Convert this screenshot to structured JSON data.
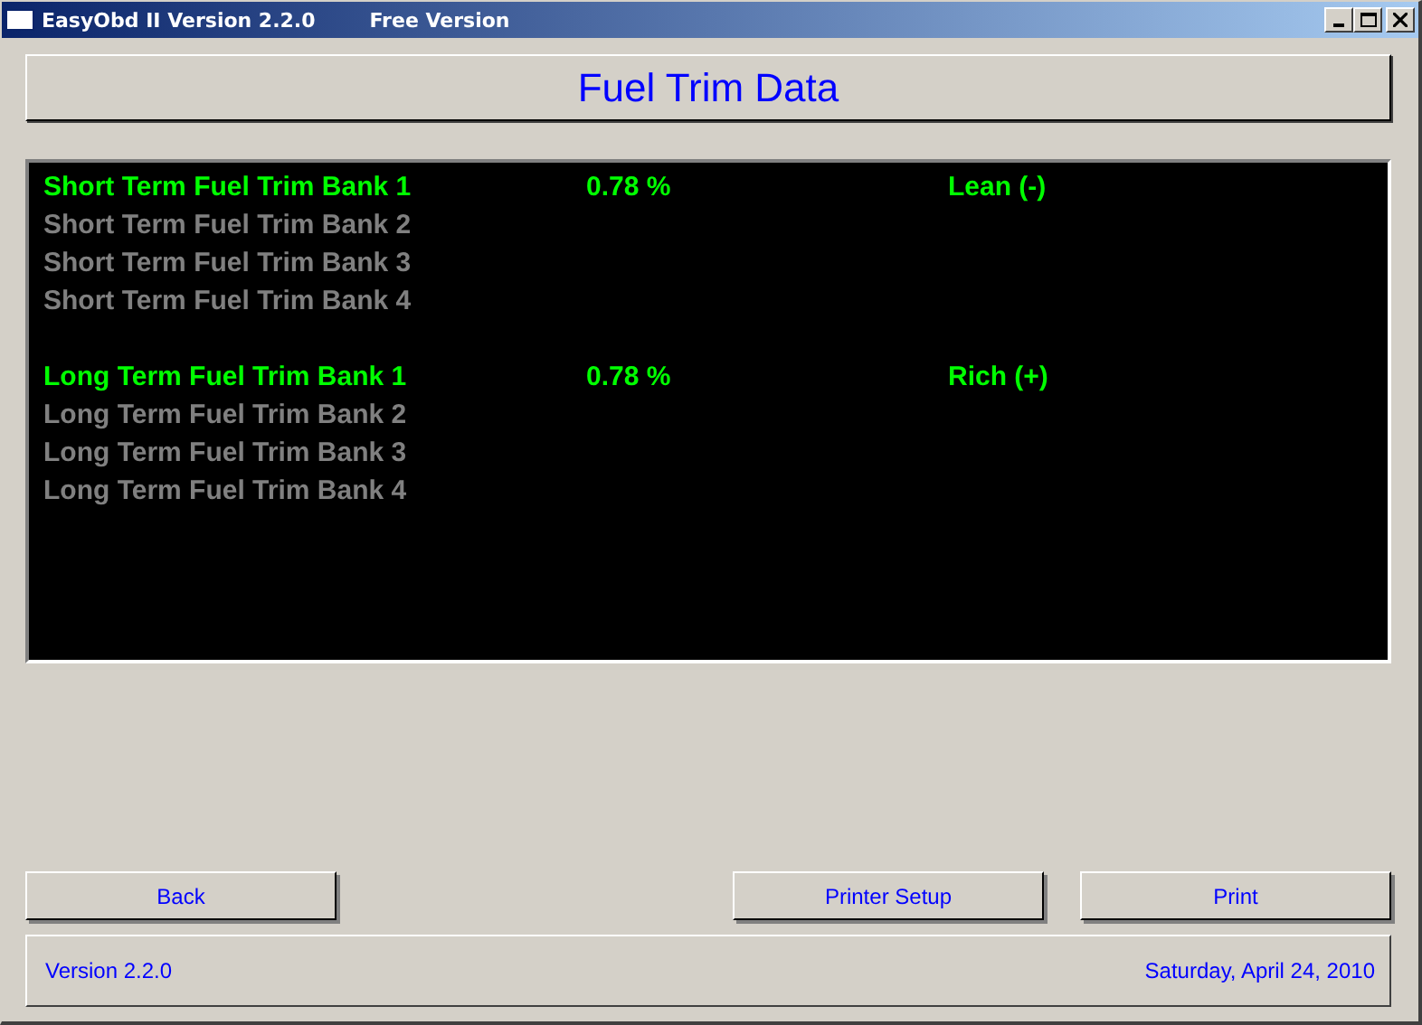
{
  "window": {
    "title": "EasyObd II Version 2.2.0",
    "subtitle": "Free Version"
  },
  "header": "Fuel Trim Data",
  "groups": [
    {
      "rows": [
        {
          "label": "Short Term Fuel Trim Bank 1",
          "active": true,
          "value": "0.78 %",
          "status": "Lean (-)"
        },
        {
          "label": "Short Term Fuel Trim Bank 2",
          "active": false
        },
        {
          "label": "Short Term Fuel Trim Bank 3",
          "active": false
        },
        {
          "label": "Short Term Fuel Trim Bank 4",
          "active": false
        }
      ]
    },
    {
      "rows": [
        {
          "label": "Long Term Fuel Trim Bank 1",
          "active": true,
          "value": "0.78 %",
          "status": "Rich (+)"
        },
        {
          "label": "Long Term Fuel Trim Bank 2",
          "active": false
        },
        {
          "label": "Long Term Fuel Trim Bank 3",
          "active": false
        },
        {
          "label": "Long Term Fuel Trim Bank 4",
          "active": false
        }
      ]
    }
  ],
  "buttons": {
    "left": [
      "Back"
    ],
    "right": [
      "Printer Setup",
      "Print"
    ]
  },
  "status_bar": {
    "version": "Version 2.2.0",
    "date": "Saturday, April 24, 2010"
  }
}
